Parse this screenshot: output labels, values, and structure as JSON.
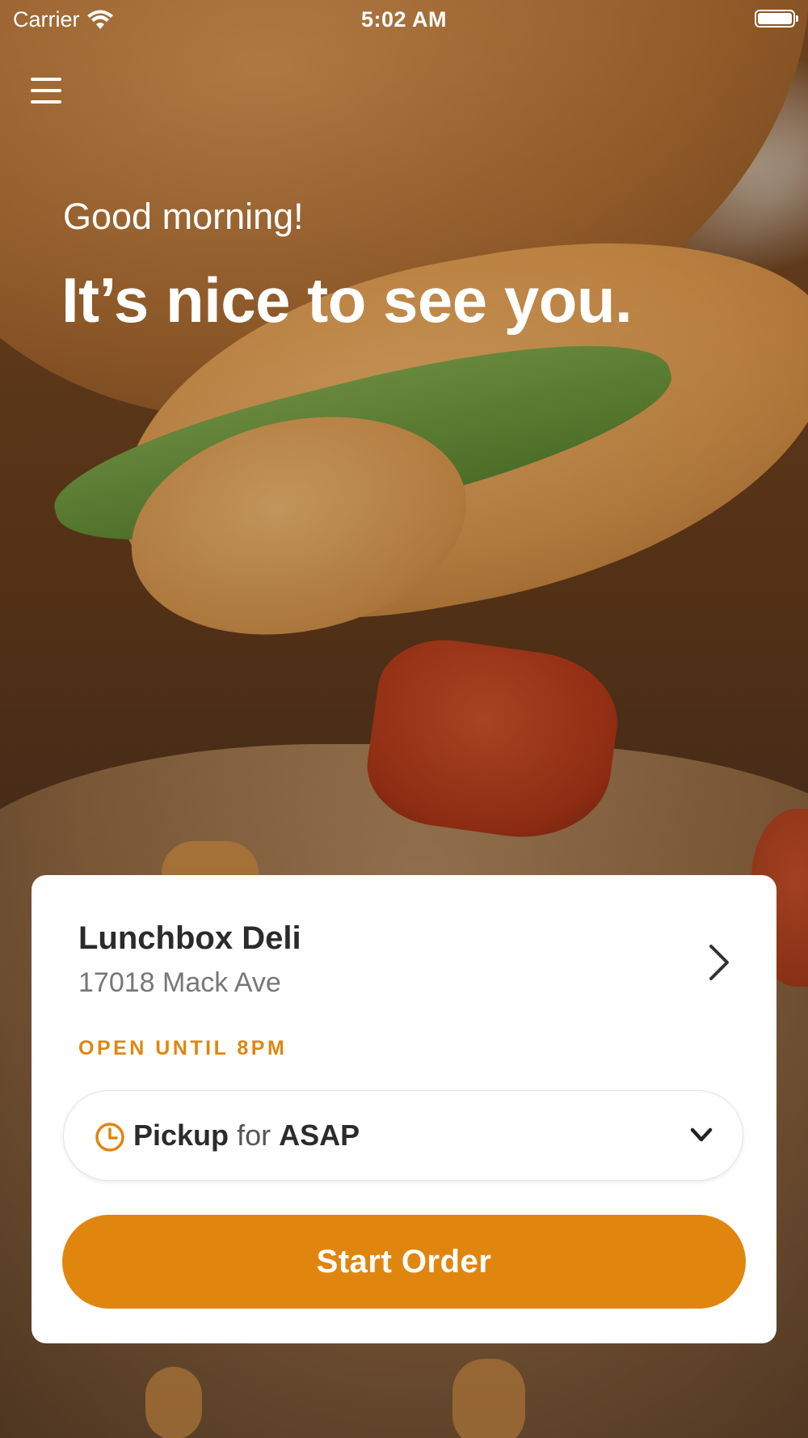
{
  "status_bar": {
    "carrier": "Carrier",
    "time": "5:02 AM",
    "wifi_icon": "wifi-icon",
    "battery_icon": "battery-full-icon"
  },
  "header": {
    "menu_icon": "hamburger-menu-icon"
  },
  "hero": {
    "greeting": "Good morning!",
    "headline": "It’s nice to see you."
  },
  "location_card": {
    "store_name": "Lunchbox Deli",
    "address": "17018 Mack Ave",
    "hours": "OPEN UNTIL 8PM",
    "order_type": {
      "mode": "Pickup",
      "connector": "for",
      "time": "ASAP"
    },
    "start_order_label": "Start Order"
  },
  "colors": {
    "accent": "#e0860e",
    "card_background": "#ffffff",
    "text_primary": "#2b2b2b",
    "text_secondary": "#777777"
  }
}
